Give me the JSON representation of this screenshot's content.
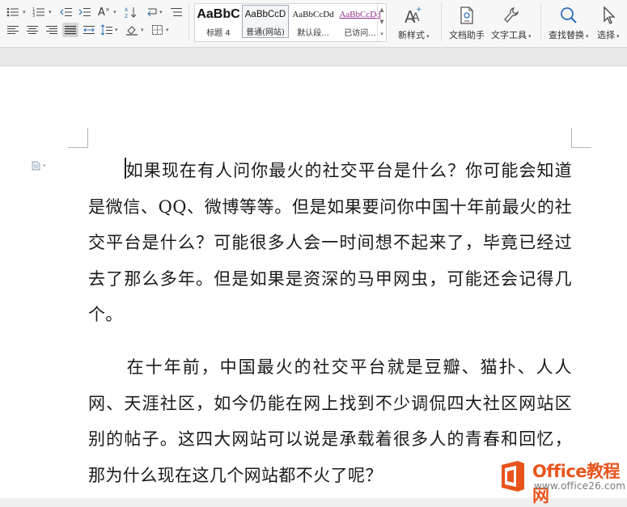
{
  "ribbon": {
    "styles": [
      {
        "sample": "AaBbC",
        "label": "标题 4",
        "selected": false
      },
      {
        "sample": "AaBbCcD",
        "label": "普通(网站)",
        "selected": true
      },
      {
        "sample": "AaBbCcDd",
        "label": "默认段...",
        "selected": false
      },
      {
        "sample": "AaBbCcDd",
        "label": "已访问...",
        "selected": false
      }
    ],
    "new_style_label": "新样式",
    "doc_helper_label": "文档助手",
    "text_tools_label": "文字工具",
    "find_replace_label": "查找替换",
    "select_label": "选择"
  },
  "document": {
    "paragraphs": [
      "如果现在有人问你最火的社交平台是什么？你可能会知道是微信、QQ、微博等等。但是如果要问你中国十年前最火的社交平台是什么？可能很多人会一时间想不起来了，毕竟已经过去了那么多年。但是如果是资深的马甲网虫，可能还会记得几个。",
      "在十年前，中国最火的社交平台就是豆瓣、猫扑、人人网、天涯社区，如今仍能在网上找到不少调侃四大社区网站区别的帖子。这四大网站可以说是承载着很多人的青春和回忆，那为什么现在这几个网站都不火了呢？"
    ]
  },
  "watermark": {
    "title": "Office教程网",
    "url": "www.office26.com"
  },
  "colors": {
    "accent": "#e8541b",
    "visited_link_style": "#8b2d8b"
  }
}
